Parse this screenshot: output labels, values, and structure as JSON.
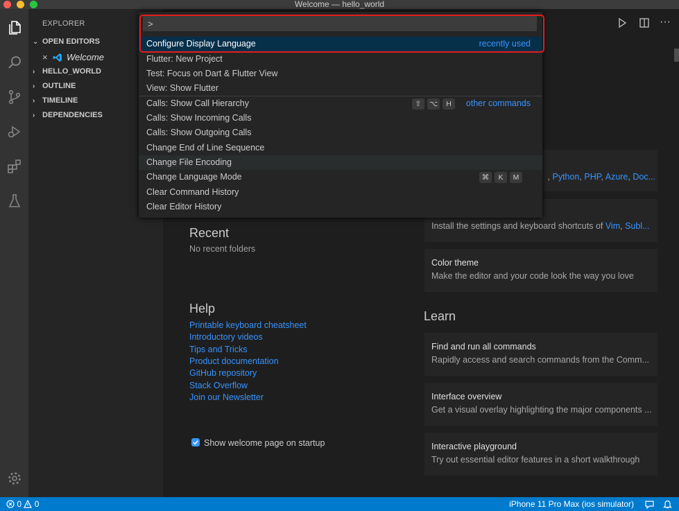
{
  "window": {
    "title": "Welcome — hello_world"
  },
  "sidebar": {
    "title": "EXPLORER",
    "open_editors": {
      "label": "OPEN EDITORS",
      "file": "Welcome"
    },
    "sections": [
      "HELLO_WORLD",
      "OUTLINE",
      "TIMELINE",
      "DEPENDENCIES"
    ]
  },
  "palette": {
    "input_value": ">",
    "items": [
      {
        "label": "Configure Display Language",
        "right": "recently used"
      },
      {
        "label": "Flutter: New Project"
      },
      {
        "label": "Test: Focus on Dart & Flutter View"
      },
      {
        "label": "View: Show Flutter"
      },
      {
        "label": "Calls: Show Call Hierarchy",
        "keys": [
          "⇧",
          "⌥",
          "H"
        ],
        "right": "other commands"
      },
      {
        "label": "Calls: Show Incoming Calls"
      },
      {
        "label": "Calls: Show Outgoing Calls"
      },
      {
        "label": "Change End of Line Sequence"
      },
      {
        "label": "Change File Encoding"
      },
      {
        "label": "Change Language Mode",
        "keys": [
          "⌘",
          "K",
          "M"
        ]
      },
      {
        "label": "Clear Command History"
      },
      {
        "label": "Clear Editor History"
      }
    ]
  },
  "welcome": {
    "recent": {
      "title": "Recent",
      "empty": "No recent folders"
    },
    "help": {
      "title": "Help",
      "links": [
        "Printable keyboard cheatsheet",
        "Introductory videos",
        "Tips and Tricks",
        "Product documentation",
        "GitHub repository",
        "Stack Overflow",
        "Join our Newsletter"
      ]
    },
    "startup_checkbox": "Show welcome page on startup",
    "customize_partial": {
      "languages": [
        "Python",
        "PHP",
        "Azure",
        "Doc..."
      ],
      "keymaps_desc": "Install the settings and keyboard shortcuts of ",
      "keymaps": [
        "Vim",
        "Subl..."
      ]
    },
    "color_theme": {
      "title": "Color theme",
      "desc": "Make the editor and your code look the way you love"
    },
    "learn": {
      "title": "Learn",
      "cards": [
        {
          "title": "Find and run all commands",
          "desc": "Rapidly access and search commands from the Comm..."
        },
        {
          "title": "Interface overview",
          "desc": "Get a visual overlay highlighting the major components ..."
        },
        {
          "title": "Interactive playground",
          "desc": "Try out essential editor features in a short walkthrough"
        }
      ]
    }
  },
  "status": {
    "errors": "0",
    "warnings": "0",
    "device": "iPhone 11 Pro Max (ios simulator)"
  },
  "colors": {
    "accent": "#007acc",
    "link": "#3794ff",
    "highlight": "#e51c1c",
    "selection": "#062f4a"
  }
}
